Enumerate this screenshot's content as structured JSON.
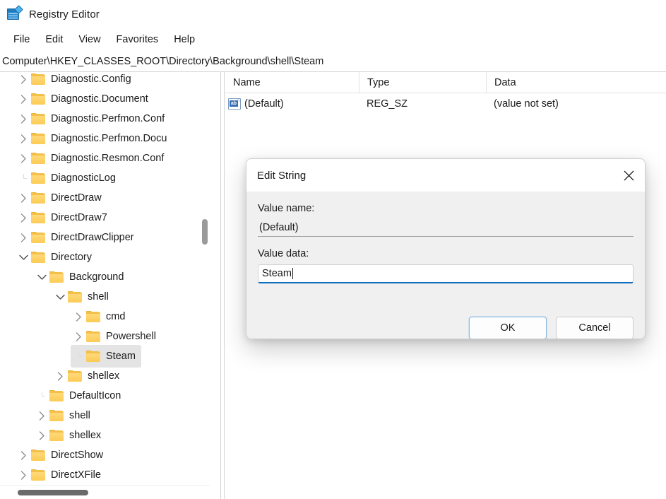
{
  "window": {
    "title": "Registry Editor",
    "icon": "registry-editor-icon"
  },
  "menu": {
    "items": [
      {
        "label": "File"
      },
      {
        "label": "Edit"
      },
      {
        "label": "View"
      },
      {
        "label": "Favorites"
      },
      {
        "label": "Help"
      }
    ]
  },
  "address": {
    "path": "Computer\\HKEY_CLASSES_ROOT\\Directory\\Background\\shell\\Steam"
  },
  "tree": {
    "items": [
      {
        "label": "Diagnostic.Config",
        "depth": 1,
        "state": "collapsed",
        "selected": false
      },
      {
        "label": "Diagnostic.Document",
        "depth": 1,
        "state": "collapsed",
        "selected": false
      },
      {
        "label": "Diagnostic.Perfmon.Conf",
        "depth": 1,
        "state": "collapsed",
        "selected": false
      },
      {
        "label": "Diagnostic.Perfmon.Docu",
        "depth": 1,
        "state": "collapsed",
        "selected": false
      },
      {
        "label": "Diagnostic.Resmon.Conf",
        "depth": 1,
        "state": "collapsed",
        "selected": false
      },
      {
        "label": "DiagnosticLog",
        "depth": 1,
        "state": "leaf",
        "selected": false
      },
      {
        "label": "DirectDraw",
        "depth": 1,
        "state": "collapsed",
        "selected": false
      },
      {
        "label": "DirectDraw7",
        "depth": 1,
        "state": "collapsed",
        "selected": false
      },
      {
        "label": "DirectDrawClipper",
        "depth": 1,
        "state": "collapsed",
        "selected": false
      },
      {
        "label": "Directory",
        "depth": 1,
        "state": "expanded",
        "selected": false
      },
      {
        "label": "Background",
        "depth": 2,
        "state": "expanded",
        "selected": false
      },
      {
        "label": "shell",
        "depth": 3,
        "state": "expanded",
        "selected": false
      },
      {
        "label": "cmd",
        "depth": 4,
        "state": "collapsed",
        "selected": false
      },
      {
        "label": "Powershell",
        "depth": 4,
        "state": "collapsed",
        "selected": false
      },
      {
        "label": "Steam",
        "depth": 4,
        "state": "leaf",
        "selected": true
      },
      {
        "label": "shellex",
        "depth": 3,
        "state": "collapsed",
        "selected": false
      },
      {
        "label": "DefaultIcon",
        "depth": 2,
        "state": "leaf",
        "selected": false
      },
      {
        "label": "shell",
        "depth": 2,
        "state": "collapsed",
        "selected": false
      },
      {
        "label": "shellex",
        "depth": 2,
        "state": "collapsed",
        "selected": false
      },
      {
        "label": "DirectShow",
        "depth": 1,
        "state": "collapsed",
        "selected": false
      },
      {
        "label": "DirectXFile",
        "depth": 1,
        "state": "collapsed",
        "selected": false
      }
    ]
  },
  "list": {
    "columns": [
      {
        "label": "Name"
      },
      {
        "label": "Type"
      },
      {
        "label": "Data"
      }
    ],
    "rows": [
      {
        "icon": "reg-sz-icon",
        "name": "(Default)",
        "type": "REG_SZ",
        "data": "(value not set)"
      }
    ]
  },
  "dialog": {
    "title": "Edit String",
    "close_icon": "close-icon",
    "value_name_label": "Value name:",
    "value_name": "(Default)",
    "value_data_label": "Value data:",
    "value_data": "Steam",
    "ok_label": "OK",
    "cancel_label": "Cancel"
  },
  "colors": {
    "accent": "#0f6cbd",
    "folder": "#f3c04a",
    "selection": "#e4e4e4",
    "dialog_bg": "#f0f0f0"
  }
}
